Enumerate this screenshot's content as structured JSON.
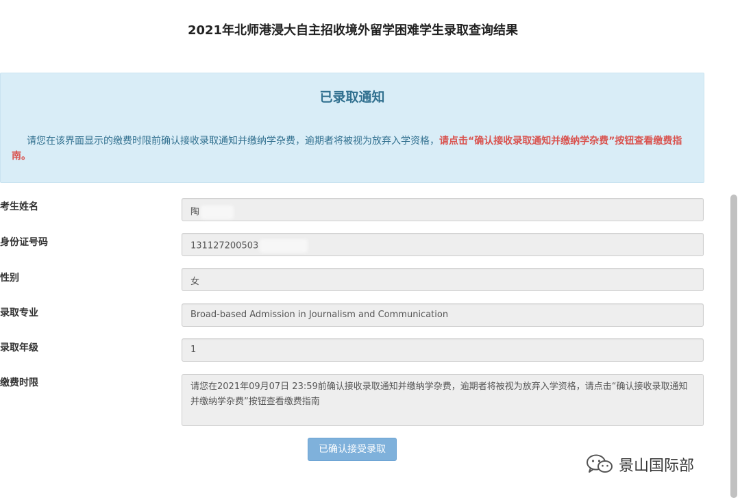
{
  "page": {
    "title": "2021年北师港浸大自主招收境外留学困难学生录取查询结果"
  },
  "notice": {
    "title": "已录取通知",
    "text_normal": "请您在该界面显示的缴费时限前确认接收录取通知并缴纳学杂费，逾期者将被视为放弃入学资格，",
    "text_red": "请点击“确认接收录取通知并缴纳学杂费”按钮查看缴费指南。"
  },
  "fields": [
    {
      "label": "考生姓名",
      "value": "陶"
    },
    {
      "label": "身份证号码",
      "value": "131127200503"
    },
    {
      "label": "性别",
      "value": "女"
    },
    {
      "label": "录取专业",
      "value": "Broad-based Admission in Journalism and Communication"
    },
    {
      "label": "录取年级",
      "value": "1"
    },
    {
      "label": "缴费时限",
      "value": "请您在2021年09月07日 23:59前确认接收录取通知并缴纳学杂费，逾期者将被视为放弃入学资格，请点击“确认接收录取通知并缴纳学杂费”按钮查看缴费指南"
    }
  ],
  "confirm_button": {
    "label": "已确认接受录取"
  },
  "watermark": {
    "icon": "wechat-icon",
    "text": "景山国际部"
  }
}
